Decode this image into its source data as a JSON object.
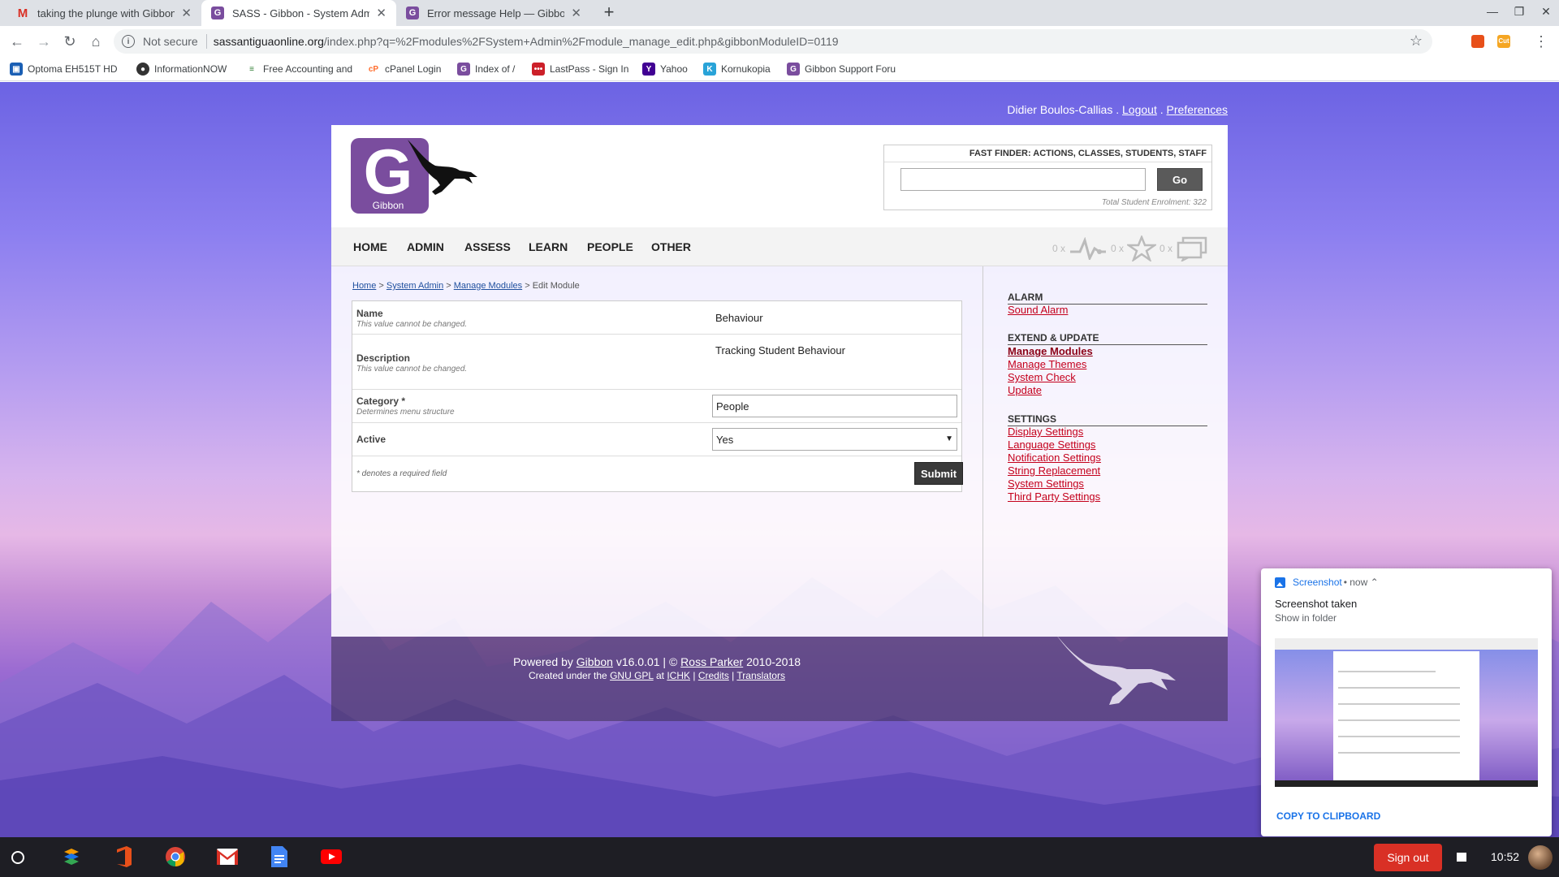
{
  "browser": {
    "tabs": [
      {
        "title": "taking the plunge with Gibbon - ",
        "favicon": "gmail-icon",
        "active": false
      },
      {
        "title": "SASS - Gibbon - System Admin",
        "favicon": "gibbon-icon",
        "active": true
      },
      {
        "title": "Error message Help — Gibbon Su",
        "favicon": "gibbon-icon",
        "active": false
      }
    ],
    "new_tab": "+",
    "security_label": "Not secure",
    "url_domain": "sassantiguaonline.org",
    "url_path": "/index.php?q=%2Fmodules%2FSystem+Admin%2Fmodule_manage_edit.php&gibbonModuleID=0119",
    "bookmarks": [
      "Optoma EH515T HD",
      "InformationNOW",
      "Free Accounting and",
      "cPanel Login",
      "Index of /",
      "LastPass - Sign In",
      "Yahoo",
      "Kornukopia",
      "Gibbon Support Foru"
    ]
  },
  "user_bar": {
    "name": "Didier Boulos-Callias",
    "sep1": " . ",
    "logout": "Logout",
    "sep2": " . ",
    "preferences": "Preferences"
  },
  "logo": {
    "letter": "G",
    "word": "Gibbon"
  },
  "fast_finder": {
    "title": "FAST FINDER: ACTIONS, CLASSES, STUDENTS, STAFF",
    "go_label": "Go",
    "enrolment": "Total Student Enrolment: 322"
  },
  "menu": [
    "HOME",
    "ADMIN",
    "ASSESS",
    "LEARN",
    "PEOPLE",
    "OTHER"
  ],
  "notifications": {
    "alarm_count": "0 x",
    "likes_count": "0 x",
    "messages_count": "0 x"
  },
  "breadcrumb": {
    "items": [
      "Home",
      "System Admin",
      "Manage Modules"
    ],
    "sep": " > ",
    "current": "Edit Module"
  },
  "form": {
    "name_label": "Name",
    "name_desc": "This value cannot be changed.",
    "name_value": "Behaviour",
    "description_label": "Description",
    "description_desc": "This value cannot be changed.",
    "description_value": "Tracking Student Behaviour",
    "category_label": "Category *",
    "category_desc": "Determines menu structure",
    "category_value": "People",
    "active_label": "Active",
    "active_value": "Yes",
    "required_note": "* denotes a required field",
    "submit_label": "Submit"
  },
  "sidebar": {
    "sections": [
      {
        "heading": "ALARM",
        "links": [
          "Sound Alarm"
        ]
      },
      {
        "heading": "EXTEND & UPDATE",
        "links": [
          "Manage Modules",
          "Manage Themes",
          "System Check",
          "Update"
        ]
      },
      {
        "heading": "SETTINGS",
        "links": [
          "Display Settings",
          "Language Settings",
          "Notification Settings",
          "String Replacement",
          "System Settings",
          "Third Party Settings"
        ]
      }
    ],
    "current": "Manage Modules"
  },
  "footer": {
    "powered_by": "Powered by ",
    "gibbon": "Gibbon",
    "version": " v16.0.01 | © ",
    "author": "Ross Parker",
    "years": " 2010-2018",
    "created_under": "Created under the ",
    "license": "GNU GPL",
    "at": " at ",
    "ichk": "ICHK",
    "pipe": " | ",
    "credits": "Credits",
    "translators": "Translators"
  },
  "notification": {
    "app": "Screenshot",
    "time": " • now ⌃",
    "title": "Screenshot taken",
    "subtitle": "Show in folder",
    "action": "COPY TO CLIPBOARD"
  },
  "shelf": {
    "sign_out": "Sign out",
    "time": "10:52"
  },
  "colors": {
    "gibbon_purple": "#7a4d9e",
    "link_red": "#c4001c",
    "signout_red": "#d93025",
    "chrome_blue": "#1a73e8"
  }
}
